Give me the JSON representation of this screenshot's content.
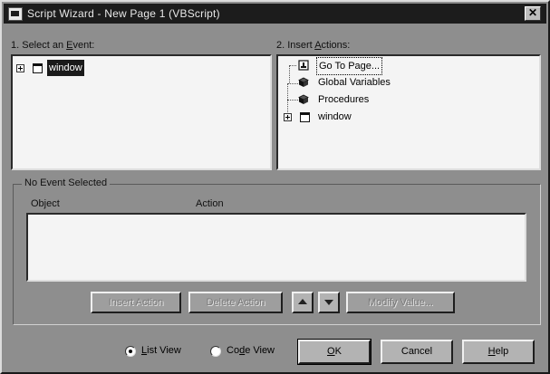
{
  "window": {
    "title": "Script Wizard - New Page 1 (VBScript)",
    "close_glyph": "✕"
  },
  "events_panel": {
    "label_prefix": "1. Select an ",
    "label_accel": "E",
    "label_suffix": "vent:",
    "items": [
      {
        "label": "window",
        "icon": "window-icon",
        "expanded": false,
        "selected": true
      }
    ]
  },
  "actions_panel": {
    "label_prefix": "2. Insert ",
    "label_accel": "A",
    "label_suffix": "ctions:",
    "items": [
      {
        "label": "Go To Page...",
        "icon": "page-icon",
        "focused": true
      },
      {
        "label": "Global Variables",
        "icon": "cube-icon"
      },
      {
        "label": "Procedures",
        "icon": "cube-icon"
      },
      {
        "label": "window",
        "icon": "window-icon",
        "expanded": false
      }
    ]
  },
  "event_group": {
    "title": "No Event Selected",
    "columns": [
      "Object",
      "Action"
    ]
  },
  "action_buttons": {
    "insert": "Insert Action",
    "delete": "Delete Action",
    "modify": "Modify Value..."
  },
  "view_options": {
    "list_view": {
      "prefix": "",
      "accel": "L",
      "suffix": "ist View",
      "checked": true
    },
    "code_view": {
      "prefix": "Co",
      "accel": "d",
      "suffix": "e View",
      "checked": false
    }
  },
  "footer_buttons": {
    "ok": {
      "prefix": "",
      "accel": "O",
      "suffix": "K"
    },
    "cancel": "Cancel",
    "help": {
      "prefix": "",
      "accel": "H",
      "suffix": "elp"
    }
  }
}
